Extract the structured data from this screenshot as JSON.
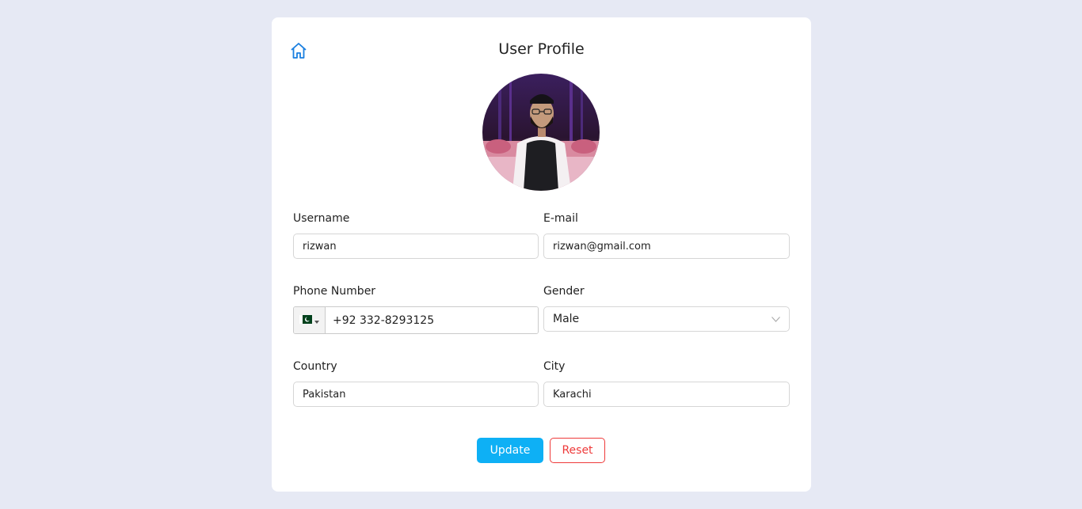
{
  "page": {
    "title": "User Profile"
  },
  "icons": {
    "home": "home-icon",
    "dropdown": "chevron-down-icon",
    "flag": "pakistan-flag-icon"
  },
  "form": {
    "username": {
      "label": "Username",
      "value": "rizwan"
    },
    "email": {
      "label": "E-mail",
      "value": "rizwan@gmail.com"
    },
    "phone": {
      "label": "Phone Number",
      "value": "+92 332-8293125"
    },
    "gender": {
      "label": "Gender",
      "value": "Male"
    },
    "country": {
      "label": "Country",
      "value": "Pakistan"
    },
    "city": {
      "label": "City",
      "value": "Karachi"
    }
  },
  "actions": {
    "update_label": "Update",
    "reset_label": "Reset"
  },
  "colors": {
    "accent": "#0eb0f5",
    "danger": "#ee3a3a",
    "home_icon": "#1a7fe0",
    "background": "#e6e9f4"
  }
}
